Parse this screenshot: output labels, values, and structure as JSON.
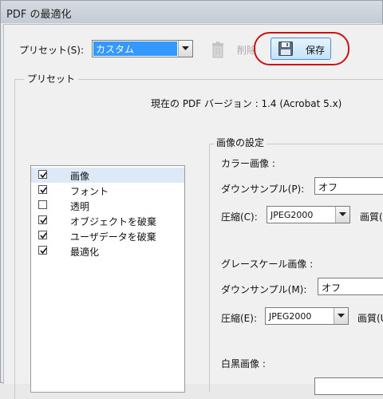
{
  "window": {
    "title": "PDF の最適化"
  },
  "preset_row": {
    "label": "プリセット(S):",
    "value": "カスタム",
    "delete_label": "削除",
    "save_label": "保存"
  },
  "preset_group": {
    "title": "プリセット"
  },
  "version_text": "現在の PDF バージョン : 1.4 (Acrobat 5.x)",
  "categories": [
    {
      "label": "画像",
      "checked": true,
      "selected": true
    },
    {
      "label": "フォント",
      "checked": true,
      "selected": false
    },
    {
      "label": "透明",
      "checked": false,
      "selected": false
    },
    {
      "label": "オブジェクトを破棄",
      "checked": true,
      "selected": false
    },
    {
      "label": "ユーザデータを破棄",
      "checked": true,
      "selected": false
    },
    {
      "label": "最適化",
      "checked": true,
      "selected": false
    }
  ],
  "image_settings": {
    "title": "画像の設定",
    "color": {
      "heading": "カラー画像 :",
      "downsample_label": "ダウンサンプル(P):",
      "downsample_value": "オフ",
      "compression_label": "圧縮(C):",
      "compression_value": "JPEG2000",
      "quality_label": "画質(Q"
    },
    "gray": {
      "heading": "グレースケール画像 :",
      "downsample_label": "ダウンサンプル(M):",
      "downsample_value": "オフ",
      "compression_label": "圧縮(E):",
      "compression_value": "JPEG2000",
      "quality_label": "画質(U"
    },
    "mono": {
      "heading": "白黒画像 :"
    }
  }
}
